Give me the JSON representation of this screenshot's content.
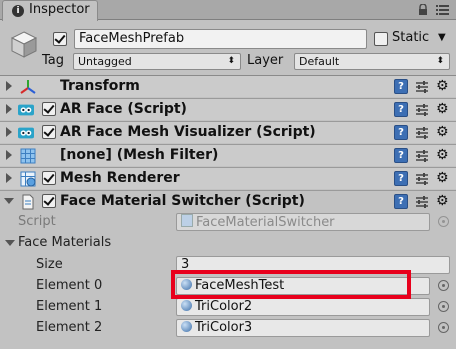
{
  "tab": {
    "title": "Inspector"
  },
  "header": {
    "object_name": "FaceMeshPrefab",
    "static_label": "Static",
    "tag_label": "Tag",
    "tag_value": "Untagged",
    "layer_label": "Layer",
    "layer_value": "Default"
  },
  "components": [
    {
      "title": "Transform",
      "icon": "transform-axes-icon",
      "has_checkbox": false,
      "expanded": false
    },
    {
      "title": "AR Face (Script)",
      "icon": "script-eyes-icon",
      "has_checkbox": true,
      "enabled": true,
      "expanded": false
    },
    {
      "title": "AR Face Mesh Visualizer (Script)",
      "icon": "script-eyes-icon",
      "has_checkbox": true,
      "enabled": true,
      "expanded": false
    },
    {
      "title": "[none] (Mesh Filter)",
      "icon": "mesh-grid-icon",
      "has_checkbox": false,
      "expanded": false
    },
    {
      "title": "Mesh Renderer",
      "icon": "mesh-renderer-icon",
      "has_checkbox": true,
      "enabled": true,
      "expanded": false
    },
    {
      "title": "Face Material Switcher (Script)",
      "icon": "script-file-icon",
      "has_checkbox": true,
      "enabled": true,
      "expanded": true
    }
  ],
  "switcher": {
    "script_label": "Script",
    "script_value": "FaceMaterialSwitcher",
    "face_materials_label": "Face Materials",
    "size_label": "Size",
    "size_value": "3",
    "elements": [
      {
        "label": "Element 0",
        "value": "FaceMeshTest"
      },
      {
        "label": "Element 1",
        "value": "TriColor2"
      },
      {
        "label": "Element 2",
        "value": "TriColor3"
      }
    ]
  },
  "colors": {
    "highlight": "#e8001c",
    "background": "#c2c2c2",
    "help_icon": "#3d6fb4"
  }
}
